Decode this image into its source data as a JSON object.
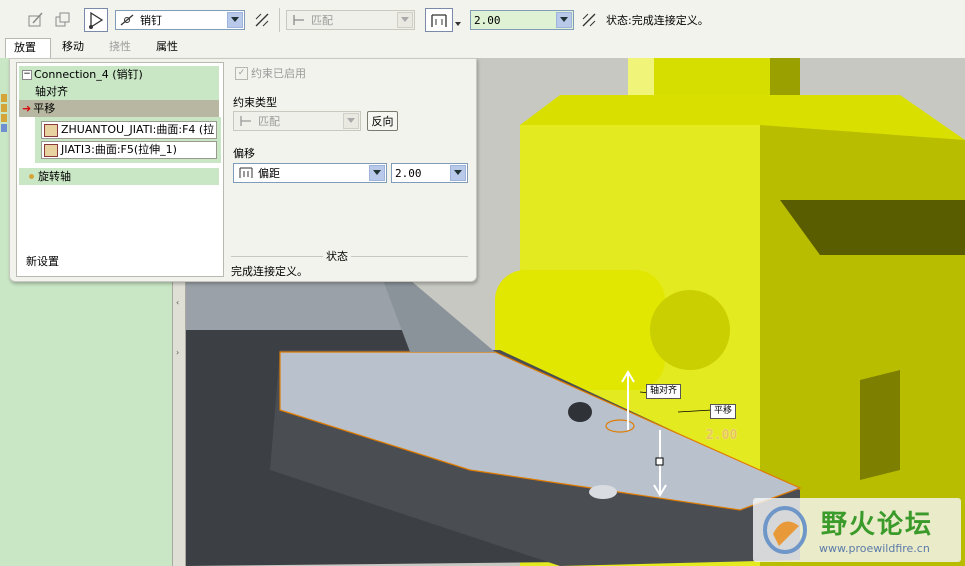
{
  "toolbar": {
    "connection_type": "销钉",
    "constraint_type": "匹配",
    "offset_value": "2.00",
    "status": "状态:完成连接定义。"
  },
  "tabs": [
    {
      "label": "放置"
    },
    {
      "label": "移动"
    },
    {
      "label": "挠性"
    },
    {
      "label": "属性"
    }
  ],
  "panel": {
    "tree": {
      "connection": "Connection_4 (销钉)",
      "axis_align": "轴对齐",
      "translate": "平移",
      "ref1": "ZHUANTOU_JIATI:曲面:F4 (拉",
      "ref2": "JIATI3:曲面:F5(拉伸_1)",
      "rotation_axis": "旋转轴",
      "new_set": "新设置"
    },
    "constraint_enabled": "约束已启用",
    "constraint_type_label": "约束类型",
    "constraint_type_value": "匹配",
    "flip_button": "反向",
    "offset_label": "偏移",
    "offset_mode": "偏距",
    "offset_value": "2.00",
    "status_heading": "状态",
    "status_text": "完成连接定义。"
  },
  "viewport": {
    "tag_axis": "轴对齐",
    "tag_translate": "平移",
    "dimension": "2.00"
  },
  "watermark": {
    "title": "野火论坛",
    "url": "www.proewildfire.cn"
  },
  "colors": {
    "toolbar_bg": "#f3f3ee",
    "model_tree_bg": "#c9e6c5",
    "part_yellow": "#d9e000",
    "part_gray": "#b9c2cc",
    "part_dark": "#4a4d52",
    "highlight_orange": "#e07b00",
    "selection_bg": "#b8b8a2"
  }
}
